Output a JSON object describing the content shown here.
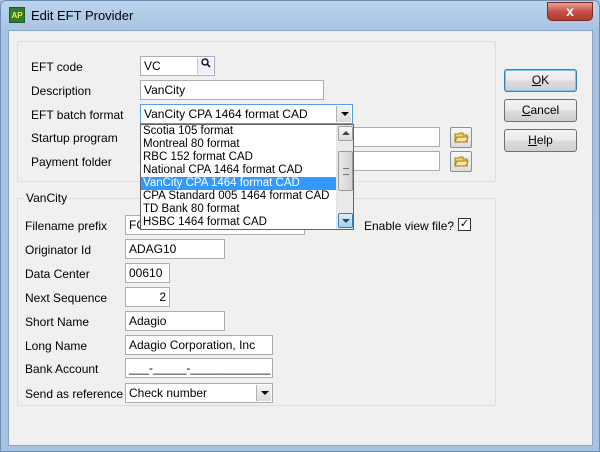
{
  "window": {
    "title": "Edit EFT Provider",
    "app_icon": "AP",
    "close_glyph": "x"
  },
  "buttons": {
    "ok": {
      "label_key": "O",
      "label_rest": "K"
    },
    "cancel": {
      "label_key": "C",
      "label_rest": "ancel"
    },
    "help": {
      "label_key": "H",
      "label_rest": "elp"
    }
  },
  "top_section": {
    "eft_code": {
      "label": "EFT code",
      "value": "VC",
      "lookup_icon": "search-icon"
    },
    "description": {
      "label": "Description",
      "value": "VanCity"
    },
    "eft_batch_format": {
      "label": "EFT batch format",
      "value": "VanCity CPA 1464 format CAD"
    },
    "startup_program": {
      "label": "Startup program",
      "value": "",
      "browse_icon": "folder-icon"
    },
    "payment_folder": {
      "label": "Payment folder",
      "value": "",
      "browse_icon": "folder-icon"
    }
  },
  "dropdown": {
    "options": [
      "Scotia 105 format",
      "Montreal 80 format",
      "RBC 152 format CAD",
      "National CPA 1464 format CAD",
      "VanCity CPA 1464 format CAD",
      "CPA Standard 005 1464 format CAD",
      "TD Bank 80 format",
      "HSBC 1464 format CAD"
    ],
    "selected_index": 4
  },
  "vancity_group": {
    "title": "VanCity",
    "filename_prefix": {
      "label": "Filename prefix",
      "value": "FC"
    },
    "enable_view_file": {
      "label": "Enable view file?",
      "checked": true,
      "check_glyph": "✓"
    },
    "originator_id": {
      "label": "Originator Id",
      "value": "ADAG10"
    },
    "data_center": {
      "label": "Data Center",
      "value": "00610"
    },
    "next_sequence": {
      "label": "Next Sequence",
      "value": "2"
    },
    "short_name": {
      "label": "Short Name",
      "value": "Adagio"
    },
    "long_name": {
      "label": "Long Name",
      "value": "Adagio Corporation, Inc"
    },
    "bank_account": {
      "label": "Bank Account",
      "value": "___-_____-____________"
    },
    "send_as_reference": {
      "label": "Send as reference",
      "value": "Check number"
    }
  }
}
